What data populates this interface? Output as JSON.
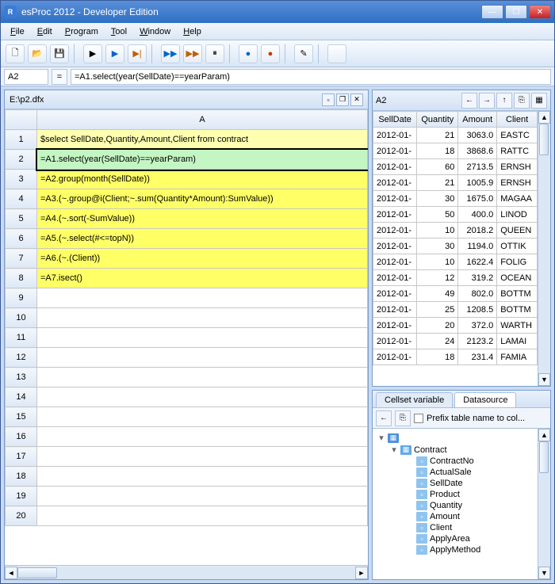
{
  "app": {
    "title": "esProc 2012 - Developer Edition",
    "icon_label": "R"
  },
  "menu": [
    "File",
    "Edit",
    "Program",
    "Tool",
    "Window",
    "Help"
  ],
  "formula": {
    "cell": "A2",
    "value": "=A1.select(year(SellDate)==yearParam)"
  },
  "doc": {
    "path": "E:\\p2.dfx"
  },
  "grid": {
    "col_header": "A",
    "rows": [
      {
        "n": 1,
        "text": "$select SellDate,Quantity,Amount,Client from contract",
        "cls": "sql"
      },
      {
        "n": 2,
        "text": "=A1.select(year(SellDate)==yearParam)",
        "cls": "selected"
      },
      {
        "n": 3,
        "text": "=A2.group(month(SellDate))",
        "cls": "code"
      },
      {
        "n": 4,
        "text": "=A3.(~.group@i(Client;~.sum(Quantity*Amount):SumValue))",
        "cls": "code"
      },
      {
        "n": 5,
        "text": "=A4.(~.sort(-SumValue))",
        "cls": "code"
      },
      {
        "n": 6,
        "text": "=A5.(~.select(#<=topN))",
        "cls": "code"
      },
      {
        "n": 7,
        "text": "=A6.(~.(Client))",
        "cls": "code"
      },
      {
        "n": 8,
        "text": "=A7.isect()",
        "cls": "code"
      },
      {
        "n": 9,
        "text": "",
        "cls": ""
      },
      {
        "n": 10,
        "text": "",
        "cls": ""
      },
      {
        "n": 11,
        "text": "",
        "cls": ""
      },
      {
        "n": 12,
        "text": "",
        "cls": ""
      },
      {
        "n": 13,
        "text": "",
        "cls": ""
      },
      {
        "n": 14,
        "text": "",
        "cls": ""
      },
      {
        "n": 15,
        "text": "",
        "cls": ""
      },
      {
        "n": 16,
        "text": "",
        "cls": ""
      },
      {
        "n": 17,
        "text": "",
        "cls": ""
      },
      {
        "n": 18,
        "text": "",
        "cls": ""
      },
      {
        "n": 19,
        "text": "",
        "cls": ""
      },
      {
        "n": 20,
        "text": "",
        "cls": ""
      }
    ]
  },
  "results": {
    "ref": "A2",
    "headers": [
      "SellDate",
      "Quantity",
      "Amount",
      "Client"
    ],
    "rows": [
      [
        "2012-01-",
        "21",
        "3063.0",
        "EASTC"
      ],
      [
        "2012-01-",
        "18",
        "3868.6",
        "RATTC"
      ],
      [
        "2012-01-",
        "60",
        "2713.5",
        "ERNSH"
      ],
      [
        "2012-01-",
        "21",
        "1005.9",
        "ERNSH"
      ],
      [
        "2012-01-",
        "30",
        "1675.0",
        "MAGAA"
      ],
      [
        "2012-01-",
        "50",
        "400.0",
        "LINOD"
      ],
      [
        "2012-01-",
        "10",
        "2018.2",
        "QUEEN"
      ],
      [
        "2012-01-",
        "30",
        "1194.0",
        "OTTIK"
      ],
      [
        "2012-01-",
        "10",
        "1622.4",
        "FOLIG"
      ],
      [
        "2012-01-",
        "12",
        "319.2",
        "OCEAN"
      ],
      [
        "2012-01-",
        "49",
        "802.0",
        "BOTTM"
      ],
      [
        "2012-01-",
        "25",
        "1208.5",
        "BOTTM"
      ],
      [
        "2012-01-",
        "20",
        "372.0",
        "WARTH"
      ],
      [
        "2012-01-",
        "24",
        "2123.2",
        "LAMAI"
      ],
      [
        "2012-01-",
        "18",
        "231.4",
        "FAMIA"
      ]
    ]
  },
  "tabs": {
    "t1": "Cellset variable",
    "t2": "Datasource"
  },
  "ds": {
    "prefix_label": "Prefix table name to col...",
    "root": "Contract",
    "cols": [
      "ContractNo",
      "ActualSale",
      "SellDate",
      "Product",
      "Quantity",
      "Amount",
      "Client",
      "ApplyArea",
      "ApplyMethod"
    ]
  }
}
